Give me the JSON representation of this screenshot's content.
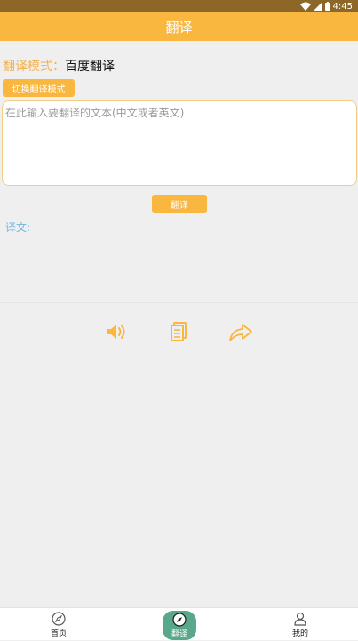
{
  "status_bar": {
    "time": "4:45"
  },
  "app_bar": {
    "title": "翻译"
  },
  "mode": {
    "label": "翻译模式：",
    "value": "百度翻译"
  },
  "switch_button": {
    "label": "切换翻译模式"
  },
  "input": {
    "placeholder": "在此输入要翻译的文本(中文或者英文)",
    "value": ""
  },
  "translate_button": {
    "label": "翻译"
  },
  "result": {
    "label": "译文:"
  },
  "actions": [
    "speaker-icon",
    "copy-icon",
    "share-icon"
  ],
  "bottom_nav": {
    "items": [
      {
        "label": "首页",
        "icon": "compass-icon"
      },
      {
        "label": "翻译",
        "icon": "compass-icon"
      },
      {
        "label": "我的",
        "icon": "user-icon"
      }
    ],
    "active_index": 1
  },
  "colors": {
    "accent": "#f9b740",
    "status_bar": "#8c6727",
    "nav_active": "#59a88a",
    "result_label": "#6fb5e6"
  }
}
